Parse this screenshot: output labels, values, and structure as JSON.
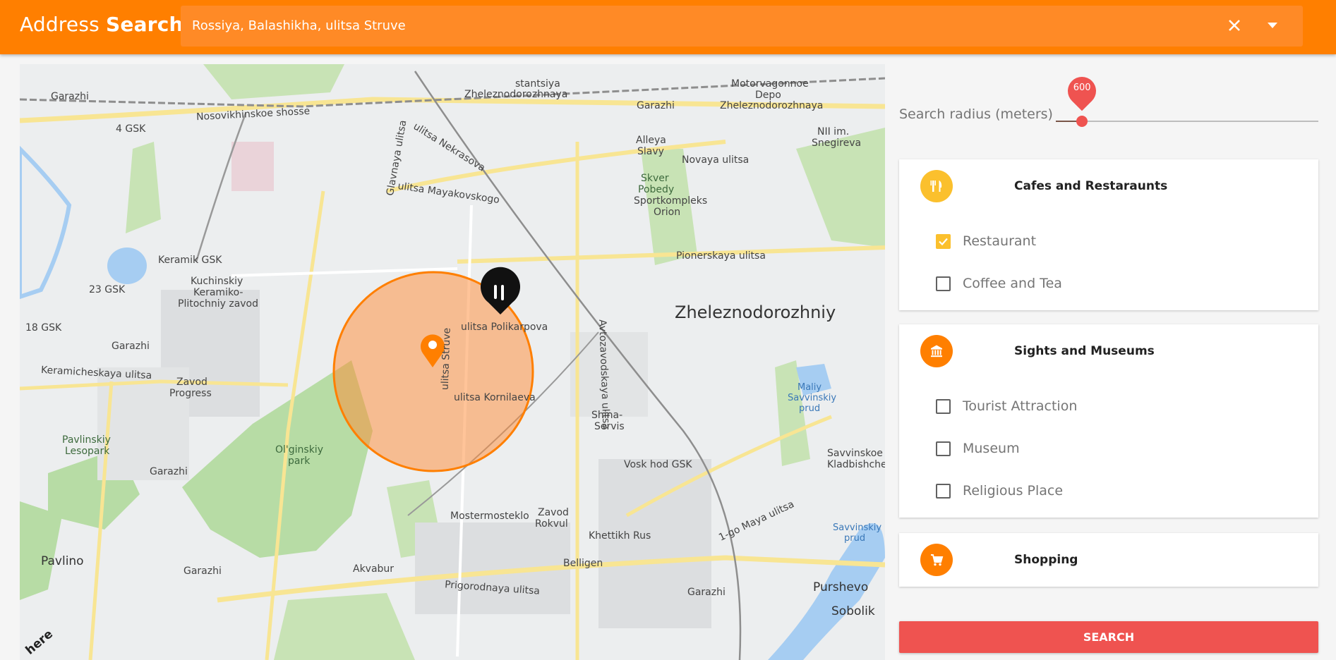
{
  "header": {
    "brand_light": "Address",
    "brand_bold": "Search",
    "search_value": "Rossiya, Balashikha, ulitsa Struve"
  },
  "map": {
    "labels": [
      {
        "text": "Zheleznodorozhniy",
        "kind": "big"
      },
      {
        "text": "Zheleznodorozhnaya"
      },
      {
        "text": "stantsiya"
      },
      {
        "text": "Motorvagonnoe"
      },
      {
        "text": "Depo"
      },
      {
        "text": "Zheleznodorozhnaya"
      },
      {
        "text": "Garazhi"
      },
      {
        "text": "Garazhi"
      },
      {
        "text": "4 GSK"
      },
      {
        "text": "Nosovikhinskoe shosse"
      },
      {
        "text": "ulitsa Nekrasova"
      },
      {
        "text": "ulitsa Mayakovskogo"
      },
      {
        "text": "Glavnaya ulitsa"
      },
      {
        "text": "Alleya"
      },
      {
        "text": "Slavy"
      },
      {
        "text": "Novaya ulitsa"
      },
      {
        "text": "NII im."
      },
      {
        "text": "Snegireva"
      },
      {
        "text": "Skver"
      },
      {
        "text": "Pobedy"
      },
      {
        "text": "Sportkompleks"
      },
      {
        "text": "Orion"
      },
      {
        "text": "Pionerskaya ulitsa"
      },
      {
        "text": "Keramik GSK"
      },
      {
        "text": "Kuchinskiy"
      },
      {
        "text": "Keramiko-"
      },
      {
        "text": "Plitochniy zavod"
      },
      {
        "text": "23 GSK"
      },
      {
        "text": "18 GSK"
      },
      {
        "text": "Garazhi"
      },
      {
        "text": "Keramicheskaya ulitsa"
      },
      {
        "text": "Zavod"
      },
      {
        "text": "Progress"
      },
      {
        "text": "ulitsa Polikarpova"
      },
      {
        "text": "ulitsa Struve"
      },
      {
        "text": "ulitsa Kornilaeva"
      },
      {
        "text": "Avtozavodskaya ulitsa"
      },
      {
        "text": "Shina-"
      },
      {
        "text": "Servis"
      },
      {
        "text": "Maliy"
      },
      {
        "text": "Savvinskiy"
      },
      {
        "text": "prud"
      },
      {
        "text": "Pavlinskiy"
      },
      {
        "text": "Lesopark"
      },
      {
        "text": "Ol'ginskiy"
      },
      {
        "text": "park"
      },
      {
        "text": "Garazhi"
      },
      {
        "text": "Vosk hod GSK"
      },
      {
        "text": "Zavod"
      },
      {
        "text": "Rokvul"
      },
      {
        "text": "Mostermosteklo"
      },
      {
        "text": "Khettikh Rus"
      },
      {
        "text": "Belligen"
      },
      {
        "text": "Savvinskoe"
      },
      {
        "text": "Kladbishche"
      },
      {
        "text": "Savvinskiy"
      },
      {
        "text": "prud"
      },
      {
        "text": "1-go Maya ulitsa"
      },
      {
        "text": "Pavlino"
      },
      {
        "text": "Garazhi"
      },
      {
        "text": "Akvabur"
      },
      {
        "text": "Prigorodnaya ulitsa"
      },
      {
        "text": "Garazhi"
      },
      {
        "text": "Purshevo"
      },
      {
        "text": "Sobolik"
      },
      {
        "text": "here"
      }
    ]
  },
  "panel": {
    "radius_label": "Search radius (meters)",
    "radius_value": "600",
    "radius_fraction": 0.1,
    "categories": [
      {
        "title": "Cafes and Restaraunts",
        "icon": "fork-knife-icon",
        "color": "#fbc02d",
        "options": [
          {
            "label": "Restaurant",
            "checked": true
          },
          {
            "label": "Coffee and Tea",
            "checked": false
          }
        ]
      },
      {
        "title": "Sights and Museums",
        "icon": "museum-icon",
        "color": "#ff7f00",
        "options": [
          {
            "label": "Tourist Attraction",
            "checked": false
          },
          {
            "label": "Museum",
            "checked": false
          },
          {
            "label": "Religious Place",
            "checked": false
          }
        ]
      },
      {
        "title": "Shopping",
        "icon": "cart-icon",
        "color": "#ff7f00",
        "options": []
      }
    ],
    "search_button": "SEARCH"
  },
  "colors": {
    "header": "#ff7f00",
    "accent": "#ef5350",
    "checkbox_checked": "#fbc02d",
    "radius_circle": "#ff8a33"
  }
}
